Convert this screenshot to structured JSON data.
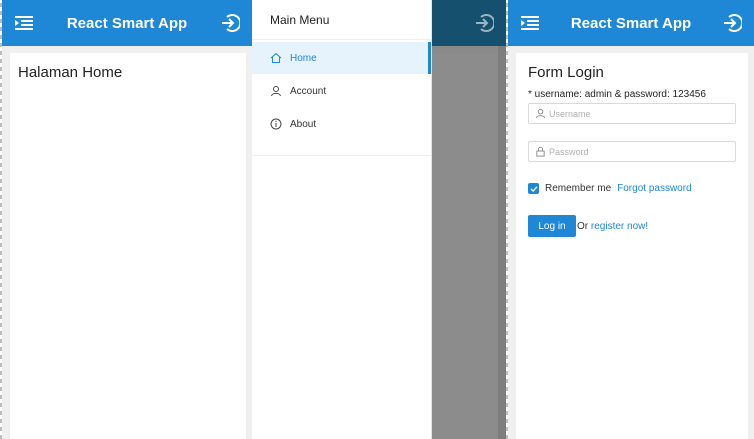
{
  "app": {
    "title": "React Smart App"
  },
  "home": {
    "heading": "Halaman Home"
  },
  "drawer": {
    "title": "Main Menu",
    "items": [
      {
        "label": "Home",
        "icon": "home-icon",
        "active": true
      },
      {
        "label": "Account",
        "icon": "user-icon",
        "active": false
      },
      {
        "label": "About",
        "icon": "info-icon",
        "active": false
      }
    ]
  },
  "login": {
    "heading": "Form Login",
    "hint": "* username: admin & password: 123456",
    "username_placeholder": "Username",
    "password_placeholder": "Password",
    "remember_label": "Remember me",
    "remember_checked": true,
    "forgot_label": "Forgot password",
    "submit_label": "Log in",
    "or_text": "Or",
    "register_label": "register now!"
  },
  "colors": {
    "primary": "#1e88d6",
    "header_dimmed": "#16506f",
    "overlay": "#8c8c8c",
    "background": "#f0f0f0"
  }
}
